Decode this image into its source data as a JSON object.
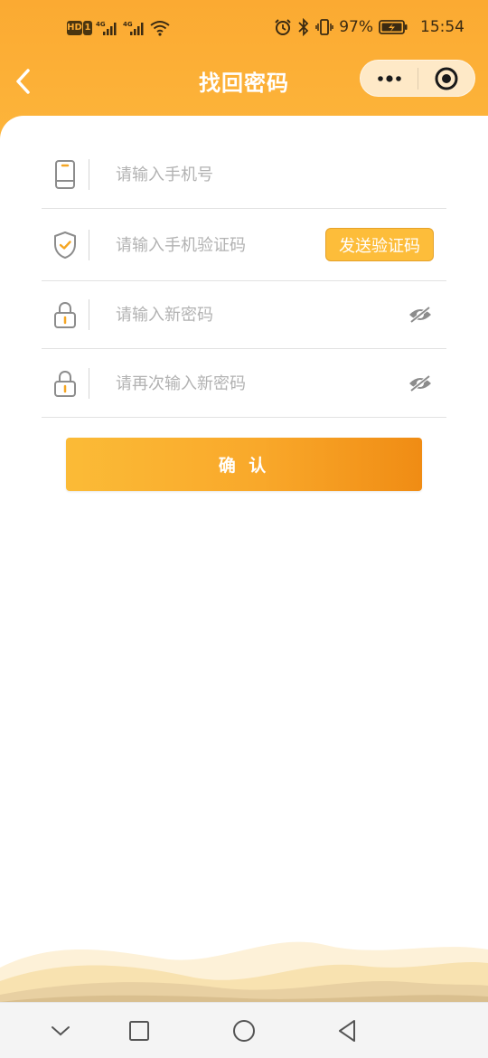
{
  "status_bar": {
    "hd_label": "HD",
    "sim_label": "1",
    "network_1": "4G",
    "network_2": "4G",
    "battery_percent": "97%",
    "time": "15:54",
    "icons": [
      "signal-icon",
      "wifi-icon",
      "alarm-icon",
      "bluetooth-icon",
      "vibrate-icon",
      "battery-charging-icon"
    ]
  },
  "nav": {
    "title": "找回密码",
    "back_icon": "chevron-left-icon",
    "more_icon": "more-dots-icon",
    "close_icon": "target-circle-icon"
  },
  "form": {
    "phone": {
      "placeholder": "请输入手机号",
      "icon": "phone-icon"
    },
    "code": {
      "placeholder": "请输入手机验证码",
      "icon": "shield-check-icon",
      "send_label": "发送验证码"
    },
    "new_password": {
      "placeholder": "请输入新密码",
      "icon": "lock-icon",
      "toggle_icon": "eye-hidden-icon"
    },
    "confirm_password": {
      "placeholder": "请再次输入新密码",
      "icon": "lock-icon",
      "toggle_icon": "eye-hidden-icon"
    }
  },
  "confirm_label": "确 认",
  "bottom_nav": {
    "icons": [
      "collapse-chevron-icon",
      "recents-square-icon",
      "home-circle-icon",
      "back-triangle-icon"
    ]
  },
  "colors": {
    "accent": "#fbaa32",
    "button_start": "#fbbb37",
    "button_end": "#f08c14",
    "icon_gray": "#8c8c8c",
    "icon_orange": "#f5a623"
  }
}
